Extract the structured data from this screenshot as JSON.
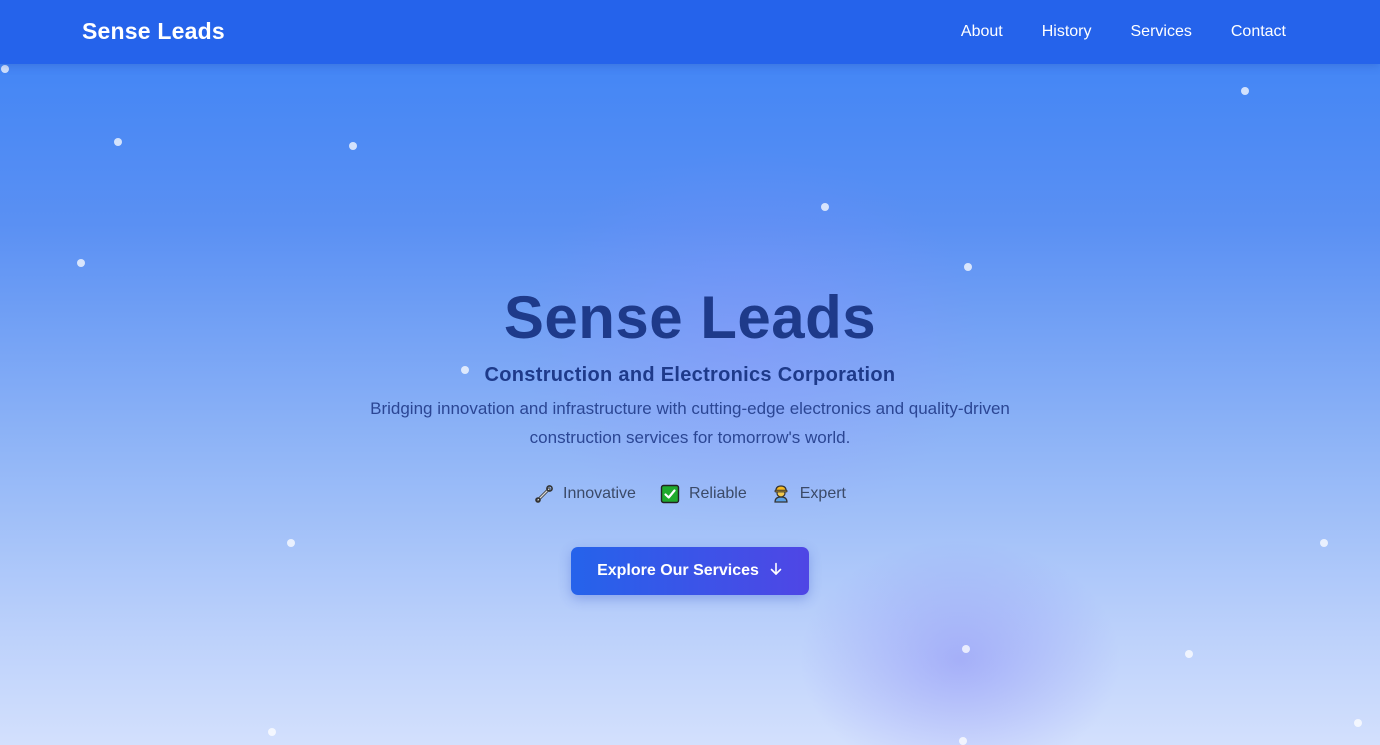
{
  "nav": {
    "brand": "Sense Leads",
    "links": [
      "About",
      "History",
      "Services",
      "Contact"
    ]
  },
  "hero": {
    "title": "Sense Leads",
    "subtitle": "Construction and Electronics Corporation",
    "description": "Bridging innovation and infrastructure with cutting-edge electronics and quality-driven construction services for tomorrow's world.",
    "features": [
      {
        "icon": "wrench-icon",
        "label": "Innovative"
      },
      {
        "icon": "check-box-icon",
        "label": "Reliable"
      },
      {
        "icon": "construction-worker-icon",
        "label": "Expert"
      }
    ],
    "cta_label": "Explore Our Services",
    "cta_icon": "arrow-down-icon"
  },
  "colors": {
    "nav_bg": "#2563eb",
    "title": "#1e3a8a",
    "cta_start": "#2563eb",
    "cta_end": "#4f46e5"
  }
}
